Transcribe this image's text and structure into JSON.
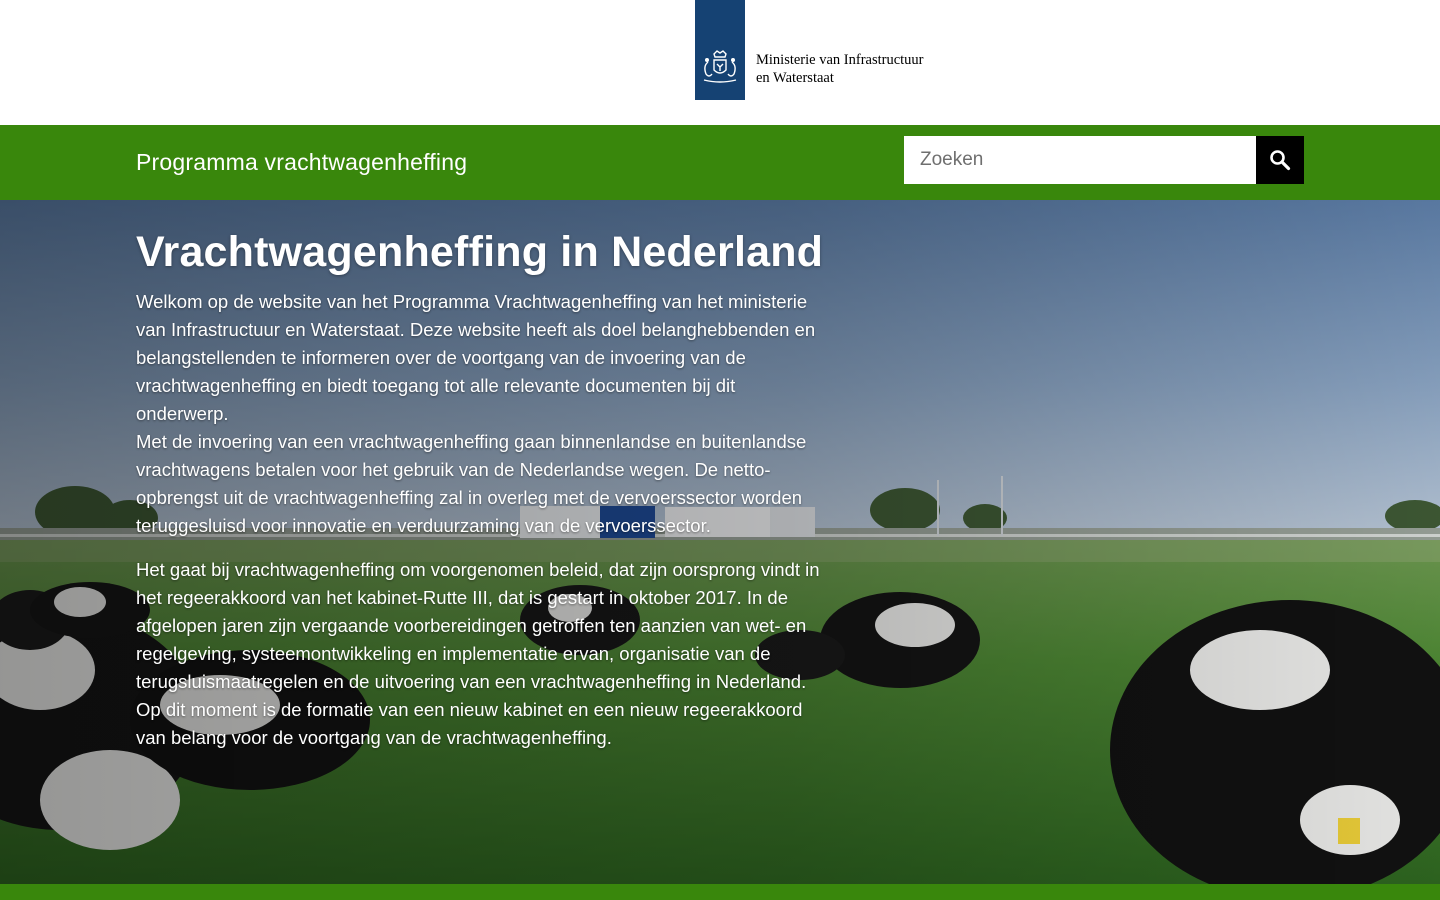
{
  "header": {
    "ministry_line1": "Ministerie van Infrastructuur",
    "ministry_line2": "en Waterstaat",
    "logo_color": "#154273"
  },
  "nav": {
    "program_title": "Programma vrachtwagenheffing",
    "search_placeholder": "Zoeken",
    "search_icon": "search-icon",
    "bar_color": "#39870c"
  },
  "hero": {
    "title": "Vrachtwagenheffing in Nederland",
    "paragraph1": "Welkom op de website van het Programma Vrachtwagenheffing van het ministerie van Infrastructuur en Waterstaat. Deze website heeft als doel belanghebbenden en belangstellenden te informeren over de voortgang van de invoering van de vrachtwagenheffing en biedt toegang tot alle relevante documenten bij dit onderwerp.",
    "paragraph2": "Met de invoering van een vrachtwagenheffing gaan binnenlandse en buitenlandse vrachtwagens betalen voor het gebruik van de Nederlandse wegen. De netto-opbrengst uit de vrachtwagenheffing zal in overleg met de vervoerssector worden teruggesluisd voor innovatie en verduurzaming van de vervoerssector.",
    "paragraph3": "Het gaat bij vrachtwagenheffing om voorgenomen beleid, dat zijn oorsprong vindt in het regeerakkoord van het kabinet-Rutte III, dat is gestart in oktober 2017. In de afgelopen jaren zijn vergaande voorbereidingen getroffen ten aanzien van wet- en regelgeving, systeemontwikkeling en implementatie ervan, organisatie van de terugsluismaatregelen en de uitvoering van een vrachtwagenheffing in Nederland. Op dit moment is de formatie van een nieuw kabinet en een nieuw regeerakkoord van belang voor de voortgang van de vrachtwagenheffing."
  }
}
